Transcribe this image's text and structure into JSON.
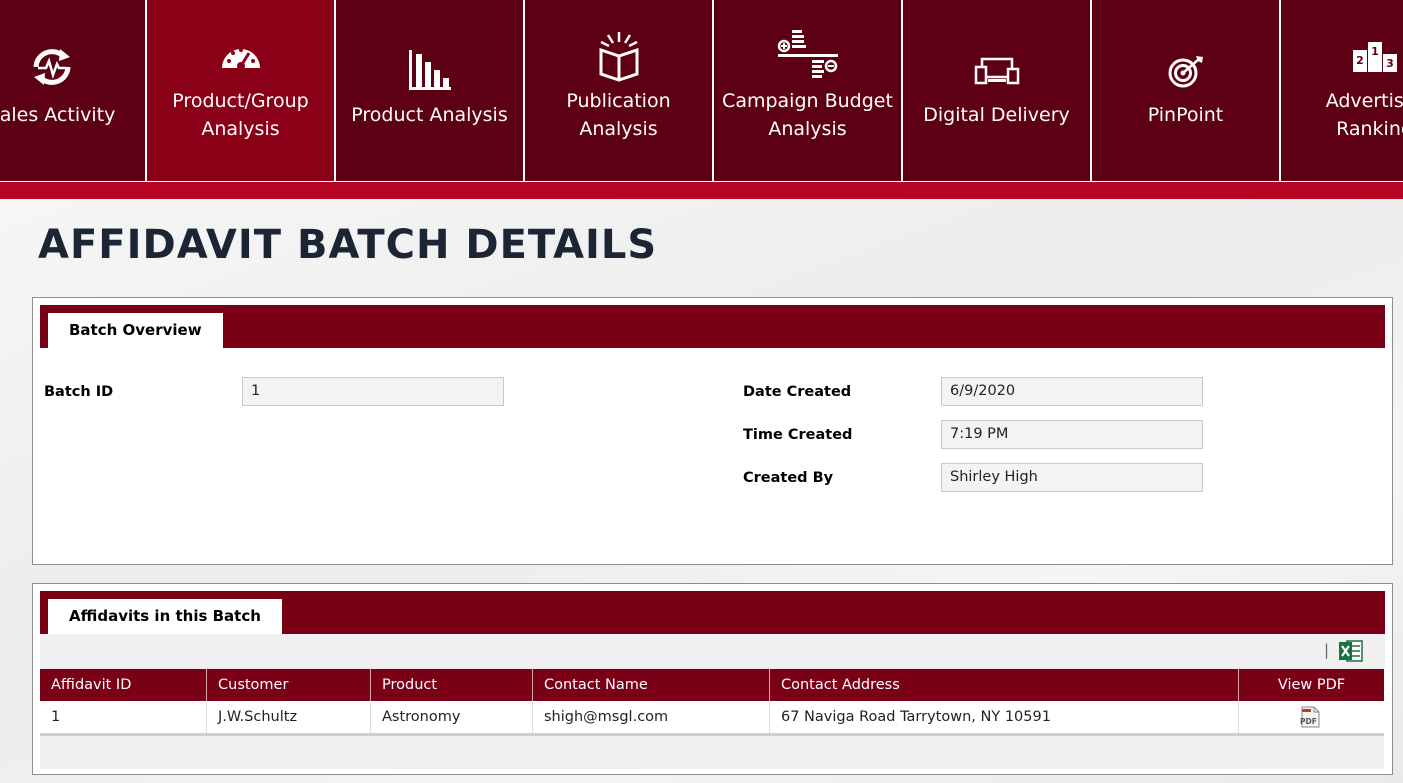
{
  "nav": {
    "tiles": [
      {
        "label": "Sales Activity",
        "icon": "activity-cycle-icon"
      },
      {
        "label": "Product/Group\nAnalysis",
        "icon": "speedometer-icon"
      },
      {
        "label": "Product Analysis",
        "icon": "bar-chart-icon"
      },
      {
        "label": "Publication\nAnalysis",
        "icon": "open-book-icon"
      },
      {
        "label": "Campaign Budget\nAnalysis",
        "icon": "coins-balance-icon"
      },
      {
        "label": "Digital Delivery",
        "icon": "devices-icon"
      },
      {
        "label": "PinPoint",
        "icon": "target-icon"
      },
      {
        "label": "Advertiser\nRanking",
        "icon": "podium-icon"
      }
    ],
    "active_index": 1
  },
  "page": {
    "title": "AFFIDAVIT BATCH DETAILS"
  },
  "overview": {
    "tab_label": "Batch Overview",
    "batch_id_label": "Batch ID",
    "batch_id_value": "1",
    "date_created_label": "Date Created",
    "date_created_value": "6/9/2020",
    "time_created_label": "Time Created",
    "time_created_value": "7:19 PM",
    "created_by_label": "Created By",
    "created_by_value": "Shirley High"
  },
  "affidavits": {
    "tab_label": "Affidavits in this Batch",
    "toolbar_separator": "|",
    "export_icon": "excel-export-icon",
    "columns": [
      "Affidavit ID",
      "Customer",
      "Product",
      "Contact Name",
      "Contact Address",
      "View PDF"
    ],
    "rows": [
      {
        "affidavit_id": "1",
        "customer": "J.W.Schultz",
        "product": "Astronomy",
        "contact_name": "shigh@msgl.com",
        "contact_address": "67 Naviga Road Tarrytown, NY 10591",
        "pdf_icon": "pdf-file-icon"
      }
    ]
  },
  "colors": {
    "nav_dark": "#5e0014",
    "nav_active": "#8a0017",
    "stripe": "#b70422",
    "panel_header": "#7a0016",
    "title": "#1c2533",
    "excel_green": "#1d6f42"
  }
}
